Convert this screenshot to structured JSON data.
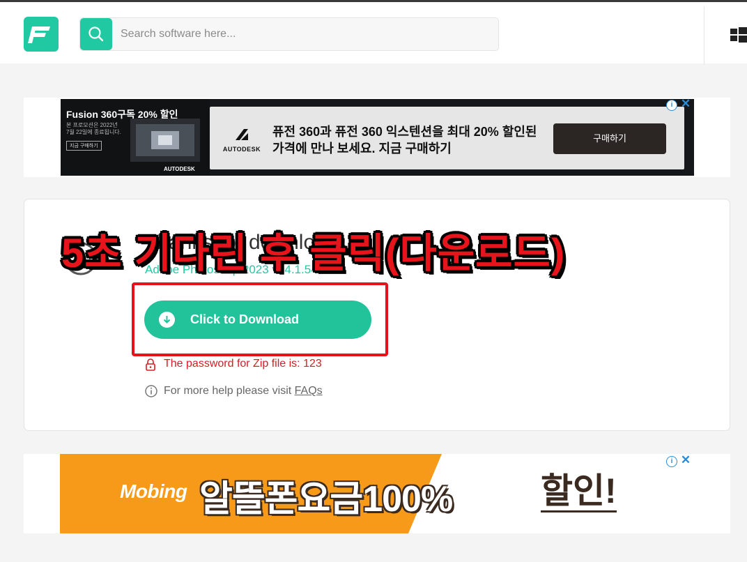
{
  "header": {
    "search_placeholder": "Search software here..."
  },
  "ad_top": {
    "left_title": "Fusion 360구독 20% 할인",
    "left_subtitle": "본 프로모션은 2022년 7월 22일에 종료됩니다.",
    "left_button": "지금 구매하기",
    "left_brand": "AUTODESK",
    "logo_text": "AUTODESK",
    "text": "퓨전 360과 퓨전 360 익스텐션을 최대 20% 할인된 가격에 만나 보세요. 지금 구매하기",
    "buy_label": "구매하기",
    "info": "i",
    "close": "✕"
  },
  "card": {
    "title": "Thanks for download",
    "subtitle": "Adobe Photoshop 2023 v24.1.547",
    "download_label": "Click to Download",
    "password_text": "The password for Zip file is:  123",
    "help_text": "For more help please visit ",
    "help_link": "FAQs"
  },
  "overlay_text": "5초 기다린 후 클릭(다운로드)",
  "ad_bottom": {
    "brand": "Mobing",
    "main": "알뜰폰요금100%",
    "discount": "할인!",
    "info": "i",
    "close": "✕"
  },
  "colors": {
    "accent": "#21c9a3",
    "download_button": "#22c39b",
    "highlight_red": "#e6121b",
    "password_red": "#d51e21"
  }
}
